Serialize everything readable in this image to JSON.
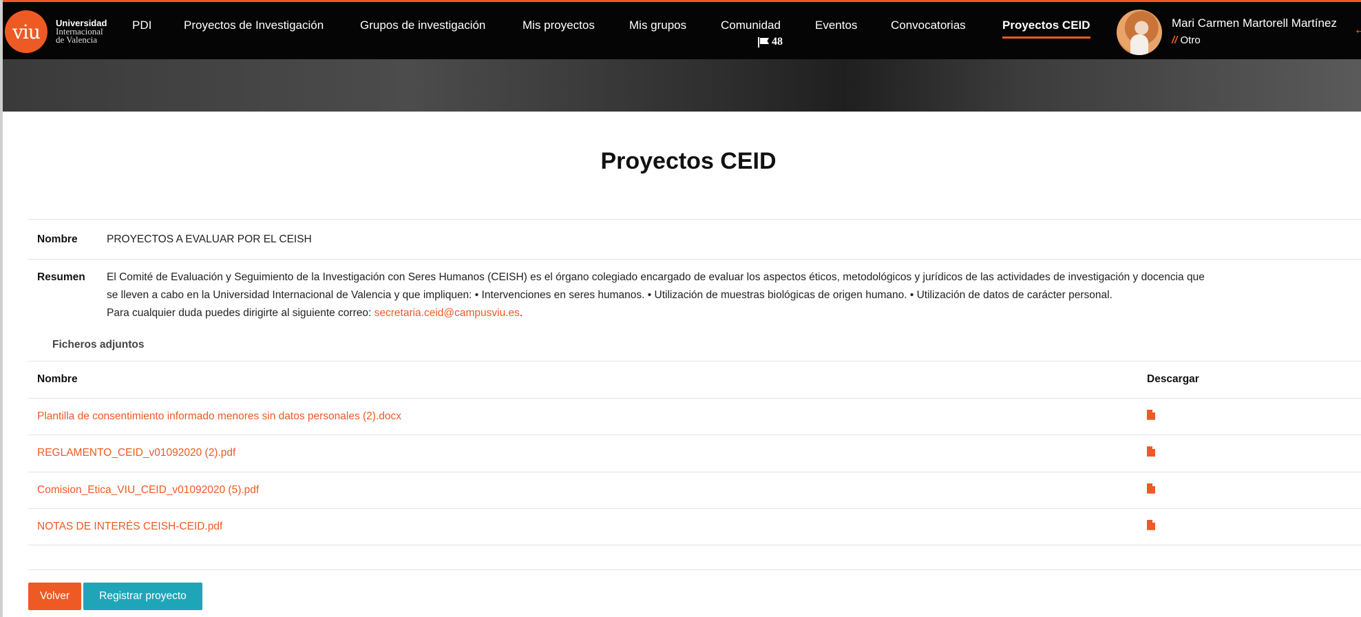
{
  "brand": {
    "logo_mark": "viu",
    "line1": "Universidad",
    "line2": "Internacional",
    "line3": "de Valencia"
  },
  "nav": {
    "items": [
      {
        "label": "PDI"
      },
      {
        "label": "Proyectos de Investigación"
      },
      {
        "label": "Grupos de investigación"
      },
      {
        "label": "Mis proyectos"
      },
      {
        "label": "Mis grupos"
      },
      {
        "label": "Comunidad"
      },
      {
        "label": "Eventos"
      },
      {
        "label": "Convocatorias"
      },
      {
        "label": "Proyectos CEID"
      }
    ],
    "active": "Proyectos CEID",
    "community_badge": "48",
    "community_badge_icon": "flag-icon"
  },
  "user": {
    "name": "Mari Carmen Martorell Martínez",
    "role_prefix": "//",
    "role": "Otro"
  },
  "page": {
    "title": "Proyectos CEID"
  },
  "details": {
    "nombre_label": "Nombre",
    "nombre_value": "PROYECTOS A EVALUAR POR EL CEISH",
    "resumen_label": "Resumen",
    "resumen_line1": "El Comité de Evaluación y Seguimiento de la Investigación con Seres Humanos (CEISH) es el órgano colegiado encargado de evaluar los aspectos éticos, metodológicos y jurídicos de las actividades de investigación y docencia que",
    "resumen_line2": "se lleven a cabo en la Universidad Internacional de Valencia y que impliquen: • Intervenciones en seres humanos. • Utilización de muestras biológicas de origen humano. • Utilización de datos de carácter personal.",
    "resumen_line3_prefix": "Para cualquier duda puedes dirigirte al siguiente correo: ",
    "email": "secretaria.ceid@campusviu.es",
    "resumen_line3_suffix": "."
  },
  "attachments": {
    "title": "Ficheros adjuntos",
    "col_name": "Nombre",
    "col_download": "Descargar",
    "files": [
      {
        "name": "Plantilla de consentimiento informado menores sin datos personales (2).docx"
      },
      {
        "name": "REGLAMENTO_CEID_v01092020 (2).pdf"
      },
      {
        "name": "Comision_Etica_VIU_CEID_v01092020 (5).pdf"
      },
      {
        "name": "NOTAS DE INTERÉS CEISH-CEID.pdf"
      }
    ],
    "download_icon": "file-icon"
  },
  "actions": {
    "back_label": "Volver",
    "register_label": "Registrar proyecto"
  },
  "colors": {
    "accent": "#ee5a24",
    "secondary": "#1ea5b8",
    "topbar": "#050505"
  }
}
